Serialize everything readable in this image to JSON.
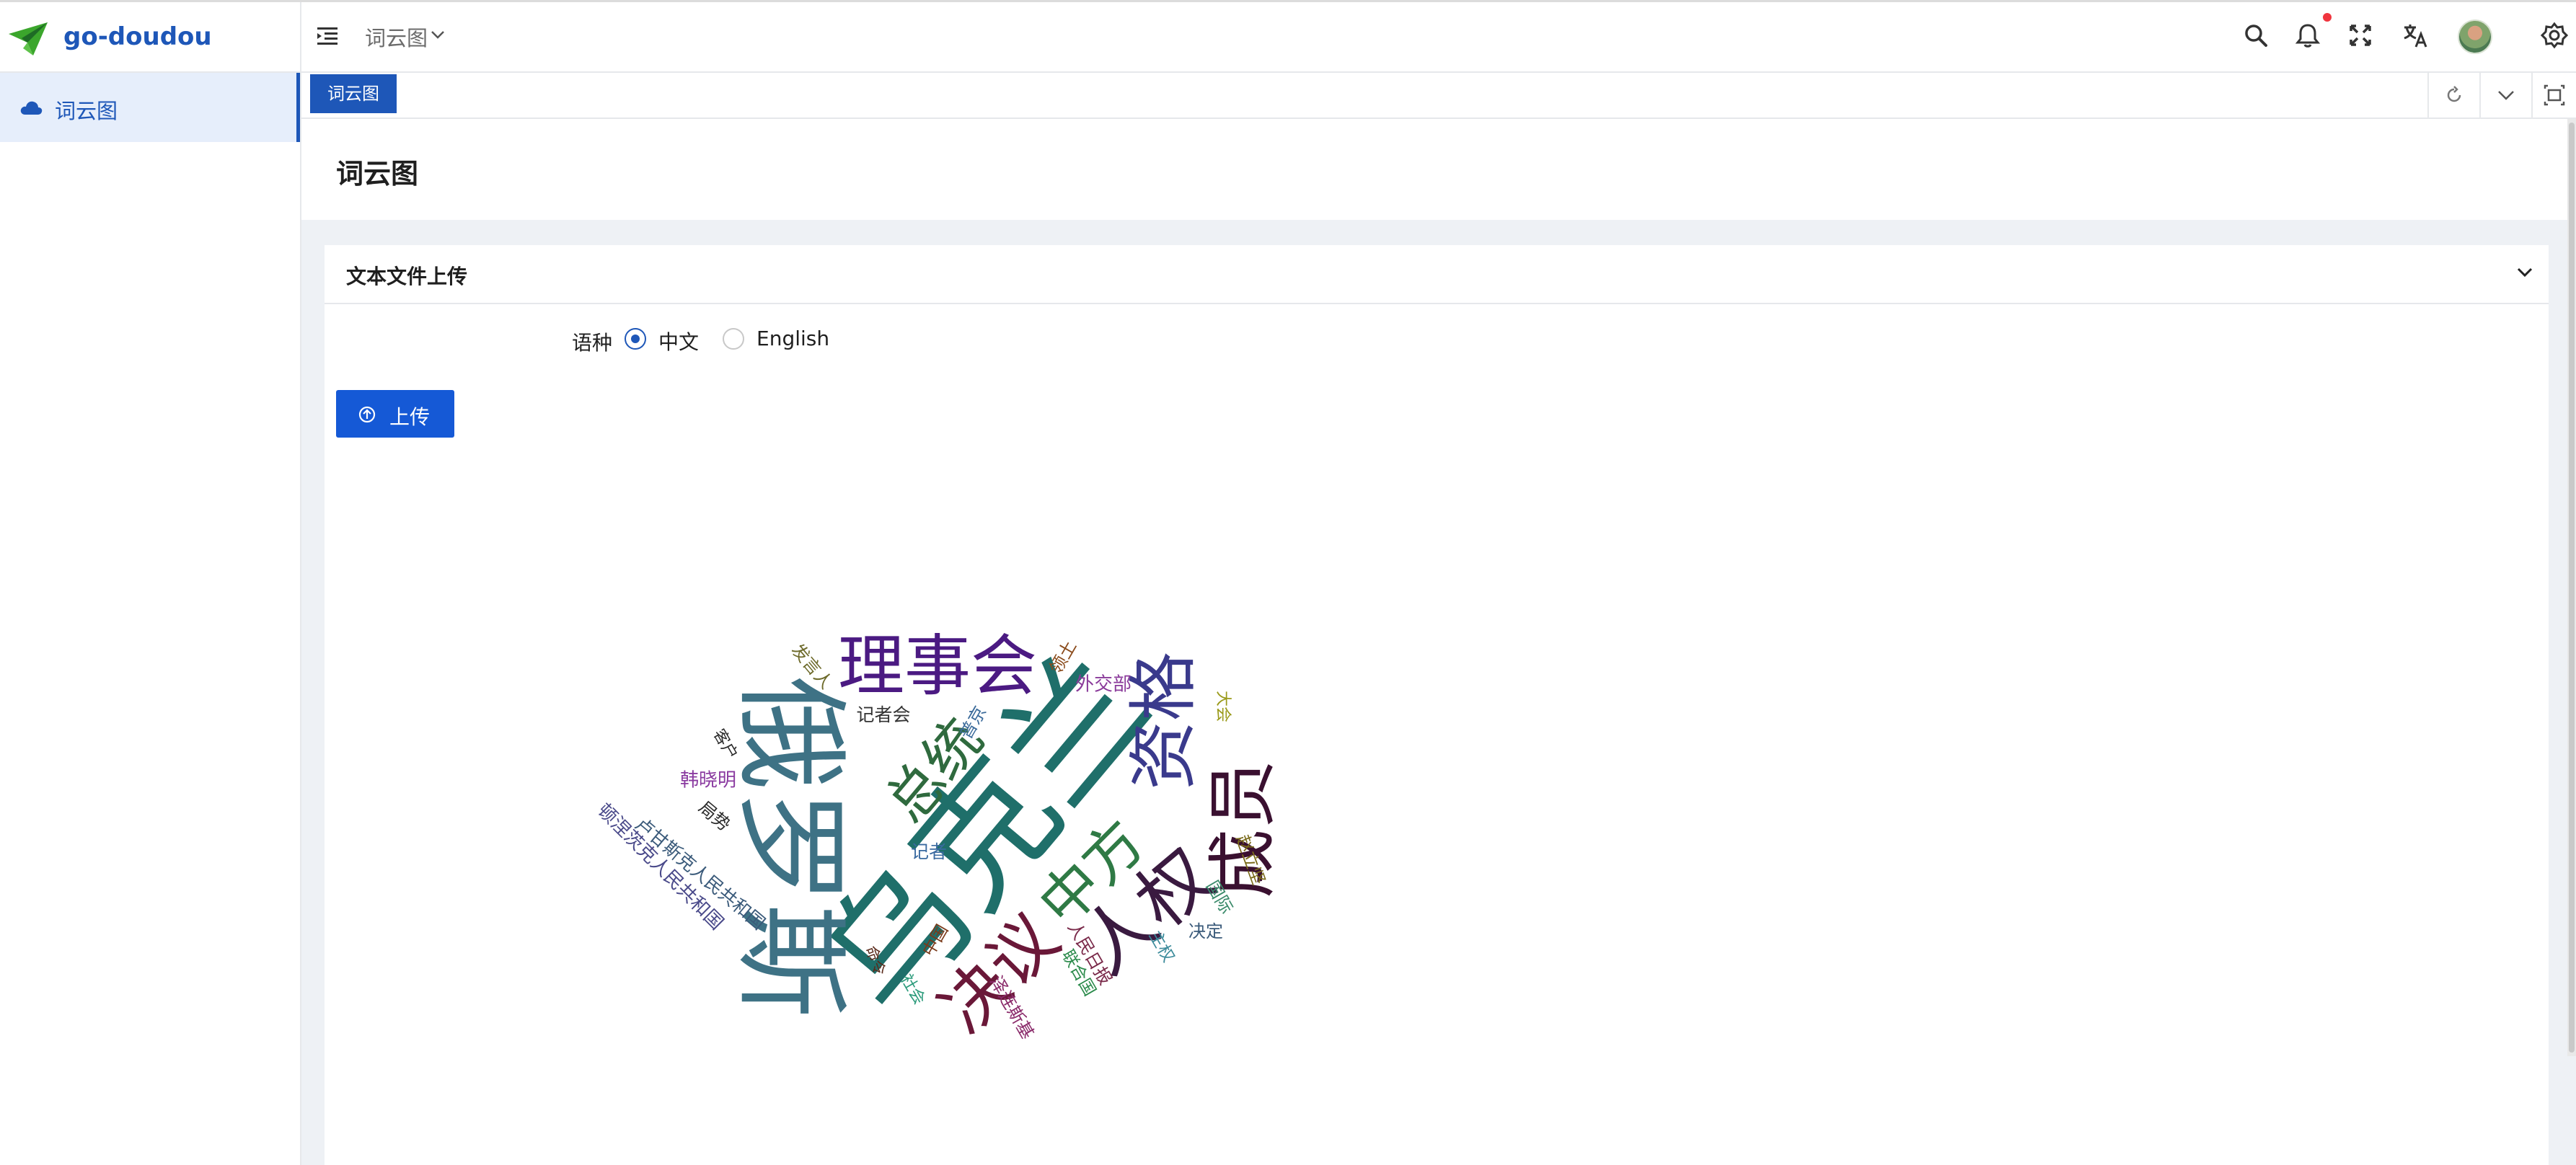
{
  "app": {
    "name": "go-doudou",
    "brand_color": "#1e57b8"
  },
  "sidebar": {
    "items": [
      {
        "label": "词云图",
        "icon": "cloud-icon",
        "active": true
      }
    ]
  },
  "header": {
    "breadcrumb": "词云图",
    "icons": [
      "menu-fold-icon",
      "search-icon",
      "bell-icon",
      "fullscreen-icon",
      "translate-icon",
      "avatar",
      "gear-icon"
    ],
    "notification_dot": true
  },
  "tabs": [
    {
      "label": "词云图",
      "active": true
    }
  ],
  "tab_tools": [
    "refresh-icon",
    "chevron-down-icon",
    "maximize-icon"
  ],
  "page": {
    "title": "词云图"
  },
  "upload_card": {
    "title": "文本文件上传",
    "language_label": "语种",
    "options": [
      {
        "label": "中文",
        "selected": true
      },
      {
        "label": "English",
        "selected": false
      }
    ],
    "upload_button": "上传"
  },
  "wordcloud": {
    "words": [
      {
        "text": "乌克兰",
        "color": "#1f6f6a"
      },
      {
        "text": "俄罗斯",
        "color": "#3e7285"
      },
      {
        "text": "理事会",
        "color": "#4b1a82"
      },
      {
        "text": "资格",
        "color": "#3a3a8c"
      },
      {
        "text": "成员",
        "color": "#3a1030"
      },
      {
        "text": "人权",
        "color": "#3a1a40"
      },
      {
        "text": "决议",
        "color": "#6a1838"
      },
      {
        "text": "中方",
        "color": "#2f7a45"
      },
      {
        "text": "总统",
        "color": "#2f6a3e"
      },
      {
        "text": "外交部",
        "color": "#8a3a9a"
      },
      {
        "text": "发言人",
        "color": "#6d6a2a"
      },
      {
        "text": "记者会",
        "color": "#333333"
      },
      {
        "text": "领土",
        "color": "#8a4a1a"
      },
      {
        "text": "大会",
        "color": "#9a9a1a"
      },
      {
        "text": "普京",
        "color": "#3a6a9a"
      },
      {
        "text": "客户",
        "color": "#2a2a2a"
      },
      {
        "text": "韩晓明",
        "color": "#8a3aa0"
      },
      {
        "text": "局势",
        "color": "#2a2a2a"
      },
      {
        "text": "卢甘斯克人民共和国",
        "color": "#3a5a7a"
      },
      {
        "text": "顿涅茨克人民共和国",
        "color": "#4a4a8a"
      },
      {
        "text": "记者",
        "color": "#3a6aa0"
      },
      {
        "text": "赵立坚",
        "color": "#7a6a1a"
      },
      {
        "text": "国际",
        "color": "#3a8a6a"
      },
      {
        "text": "决定",
        "color": "#3a5a7a"
      },
      {
        "text": "主权",
        "color": "#3a8a9a"
      },
      {
        "text": "人民日报",
        "color": "#7a2a4a"
      },
      {
        "text": "联合国",
        "color": "#2a8a4a"
      },
      {
        "text": "泽连斯基",
        "color": "#8a2a6a"
      },
      {
        "text": "中国",
        "color": "#7a3a1a"
      },
      {
        "text": "社会",
        "color": "#2a9a7a"
      },
      {
        "text": "命令",
        "color": "#5a2a1a"
      }
    ]
  }
}
